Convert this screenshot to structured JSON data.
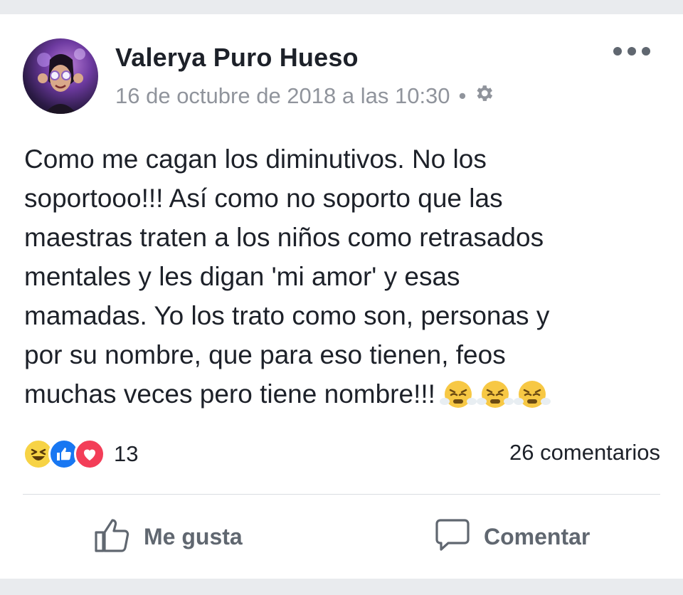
{
  "post": {
    "author": "Valerya Puro Hueso",
    "timestamp": "16 de octubre de 2018 a las 10:30",
    "separator": "•",
    "privacy_icon": "gear-icon",
    "more_icon": "more-options-icon",
    "text_lines": [
      "Como me cagan los diminutivos. No los",
      "soportooo!!! Así como no soporto que las",
      "maestras traten a los niños como retrasados",
      "mentales y les digan 'mi amor' y esas",
      "mamadas. Yo los trato como son, personas y",
      "por su nombre, que para eso tienen, feos",
      "muchas veces pero tiene nombre!!!"
    ],
    "trailing_emojis": [
      "steaming-face-emoji",
      "steaming-face-emoji",
      "steaming-face-emoji"
    ]
  },
  "reactions": {
    "icons": [
      "haha-icon",
      "like-icon",
      "love-icon"
    ],
    "count": "13",
    "comments": "26 comentarios"
  },
  "actions": {
    "like_label": "Me gusta",
    "comment_label": "Comentar"
  },
  "colors": {
    "background": "#e9ebee",
    "card": "#ffffff",
    "text": "#1d2129",
    "meta": "#90949c",
    "action": "#606770",
    "like_blue": "#1877f2",
    "love_red": "#f33e58",
    "haha_yellow": "#f7d345"
  }
}
